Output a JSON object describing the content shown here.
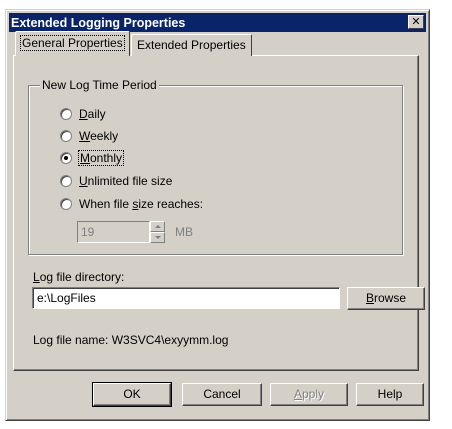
{
  "window": {
    "title": "Extended Logging Properties",
    "close_glyph": "✕"
  },
  "tabs": [
    {
      "label": "General Properties",
      "selected": true
    },
    {
      "label": "Extended Properties",
      "selected": false
    }
  ],
  "log_period": {
    "group_label": "New Log Time Period",
    "options": [
      {
        "pre": "",
        "key": "D",
        "post": "aily",
        "checked": false
      },
      {
        "pre": "",
        "key": "W",
        "post": "eekly",
        "checked": false
      },
      {
        "pre": "",
        "key": "M",
        "post": "onthly",
        "checked": true
      },
      {
        "pre": "",
        "key": "U",
        "post": "nlimited file size",
        "checked": false
      },
      {
        "pre": "When file ",
        "key": "s",
        "post": "ize reaches:",
        "checked": false
      }
    ],
    "size_value": "19",
    "size_unit": "MB"
  },
  "directory": {
    "label_key": "L",
    "label_rest": "og file directory:",
    "value": "e:\\LogFiles",
    "browse_key": "B",
    "browse_rest": "rowse"
  },
  "log_file_name": "Log file name: W3SVC4\\exyymm.log",
  "buttons": {
    "ok": "OK",
    "cancel": "Cancel",
    "apply_key": "A",
    "apply_rest": "pply",
    "help": "Help"
  },
  "colors": {
    "title_bar": "#0a246a",
    "face": "#d4d0c8"
  }
}
